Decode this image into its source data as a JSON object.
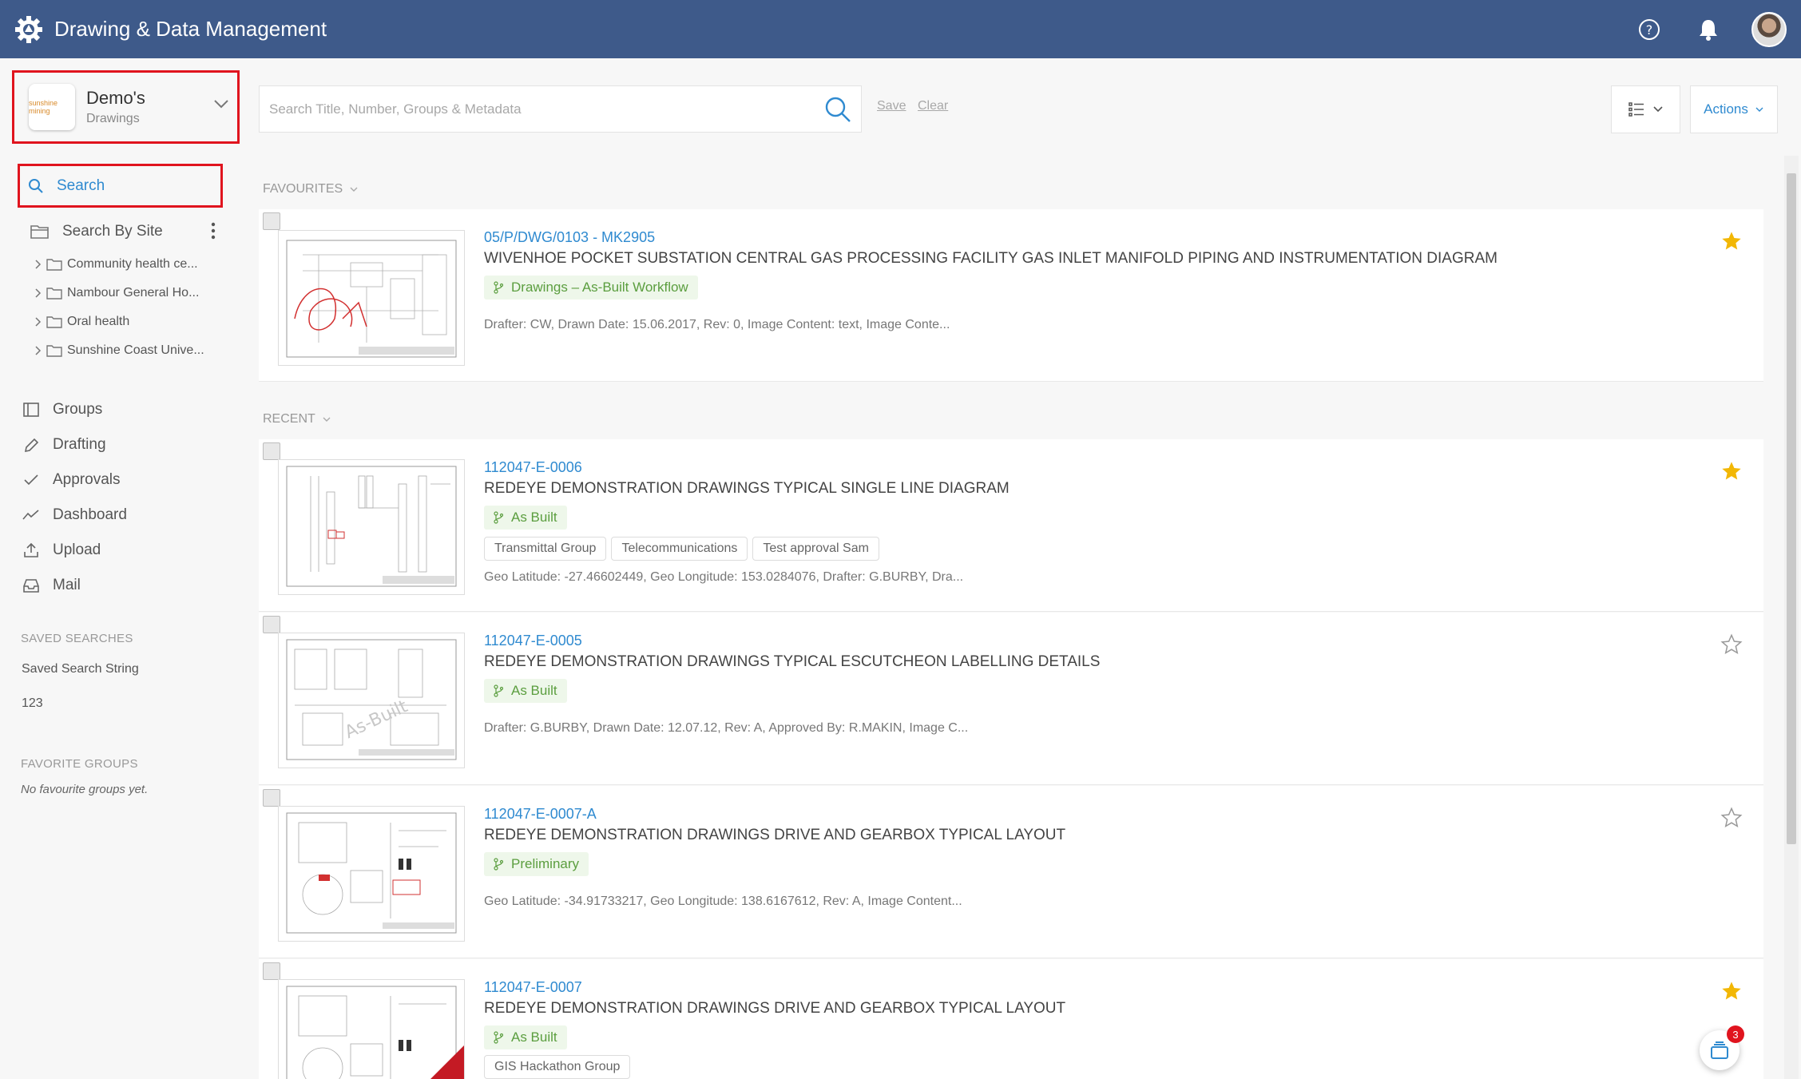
{
  "app": {
    "title": "Drawing & Data Management"
  },
  "header": {
    "help_icon": "help-circle-icon",
    "notifications_icon": "bell-icon"
  },
  "workspace": {
    "name": "Demo's",
    "subtitle": "Drawings",
    "logo_text": "sunshine mining"
  },
  "sidebar": {
    "search_label": "Search",
    "search_by_site_label": "Search By Site",
    "sites": [
      {
        "label": "Community health ce..."
      },
      {
        "label": "Nambour General Ho..."
      },
      {
        "label": "Oral health"
      },
      {
        "label": "Sunshine Coast Unive..."
      }
    ],
    "menu": [
      {
        "label": "Groups",
        "icon": "book-icon"
      },
      {
        "label": "Drafting",
        "icon": "pencil-icon"
      },
      {
        "label": "Approvals",
        "icon": "check-icon"
      },
      {
        "label": "Dashboard",
        "icon": "trend-icon"
      },
      {
        "label": "Upload",
        "icon": "upload-icon"
      },
      {
        "label": "Mail",
        "icon": "inbox-icon"
      }
    ],
    "saved_searches_heading": "SAVED SEARCHES",
    "saved_searches": [
      "Saved Search String",
      "123"
    ],
    "favorite_groups_heading": "FAVORITE GROUPS",
    "favorite_groups_empty": "No favourite groups yet."
  },
  "search": {
    "placeholder": "Search Title, Number, Groups & Metadata",
    "value": "",
    "save_label": "Save",
    "clear_label": "Clear"
  },
  "toolbar": {
    "actions_label": "Actions"
  },
  "sections": {
    "favourites": "FAVOURITES",
    "recent": "RECENT"
  },
  "favourites": [
    {
      "number": "05/P/DWG/0103 - MK2905",
      "title": "WIVENHOE POCKET SUBSTATION CENTRAL GAS PROCESSING FACILITY GAS INLET MANIFOLD PIPING AND INSTRUMENTATION DIAGRAM",
      "status": "Drawings – As-Built Workflow",
      "groups": [],
      "meta": "Drafter: CW, Drawn Date: 15.06.2017, Rev: 0, Image Content: text, Image Conte...",
      "starred": true
    }
  ],
  "recent": [
    {
      "number": "112047-E-0006",
      "title": "REDEYE DEMONSTRATION DRAWINGS TYPICAL SINGLE LINE DIAGRAM",
      "status": "As Built",
      "groups": [
        "Transmittal Group",
        "Telecommunications",
        "Test approval Sam"
      ],
      "meta": "Geo Latitude: -27.46602449, Geo Longitude: 153.0284076, Drafter: G.BURBY, Dra...",
      "starred": true
    },
    {
      "number": "112047-E-0005",
      "title": "REDEYE DEMONSTRATION DRAWINGS TYPICAL ESCUTCHEON LABELLING DETAILS",
      "status": "As Built",
      "groups": [],
      "meta": "Drafter: G.BURBY, Drawn Date: 12.07.12, Rev: A, Approved By: R.MAKIN, Image C...",
      "starred": false
    },
    {
      "number": "112047-E-0007-A",
      "title": "REDEYE DEMONSTRATION DRAWINGS DRIVE AND GEARBOX TYPICAL LAYOUT",
      "status": "Preliminary",
      "groups": [],
      "meta": "Geo Latitude: -34.91733217, Geo Longitude: 138.6167612, Rev: A, Image Content...",
      "starred": false
    },
    {
      "number": "112047-E-0007",
      "title": "REDEYE DEMONSTRATION DRAWINGS DRIVE AND GEARBOX TYPICAL LAYOUT",
      "status": "As Built",
      "groups": [
        "GIS Hackathon Group"
      ],
      "meta": "",
      "starred": true
    }
  ],
  "fab": {
    "badge_count": "3"
  },
  "colors": {
    "header": "#3e5a8a",
    "accent": "#2f8ad0",
    "status_green": "#5b9e3f",
    "star": "#f2b705",
    "highlight_red": "#e0141e"
  }
}
